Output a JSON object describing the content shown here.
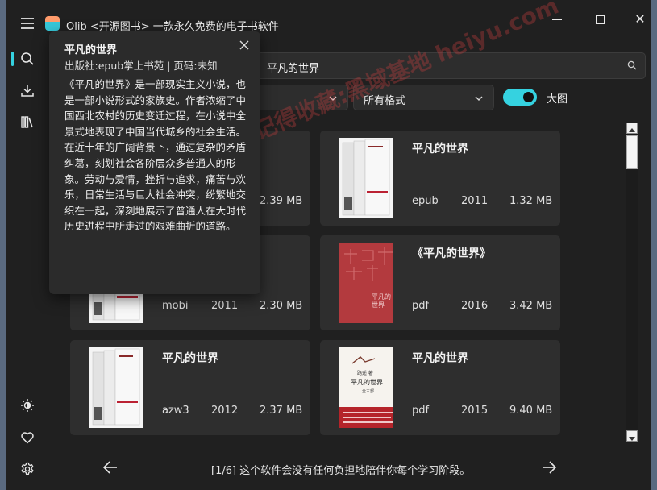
{
  "app": {
    "title": "Olib <开源图书> 一款永久免费的电子书软件"
  },
  "search": {
    "query": "平凡的世界"
  },
  "filters": {
    "sort_value": "",
    "format_value": "所有格式",
    "large_view_label": "大图",
    "large_view_on": true
  },
  "popup": {
    "title": "平凡的世界",
    "meta": "出版社:epub掌上书苑 | 页码:未知",
    "description": "《平凡的世界》是一部现实主义小说，也是一部小说形式的家族史。作者浓缩了中国西北农村的历史变迁过程，在小说中全景式地表现了中国当代城乡的社会生活。在近十年的广阔背景下，通过复杂的矛盾纠葛，刻划社会各阶层众多普通人的形象。劳动与爱情，挫折与追求，痛苦与欢乐，日常生活与巨大社会冲突，纷繁地交织在一起，深刻地展示了普通人在大时代历史进程中所走过的艰难曲折的道路。"
  },
  "results": [
    {
      "title": "",
      "format": "",
      "year": "",
      "size": "2.39 MB",
      "cover": "hidden"
    },
    {
      "title": "平凡的世界",
      "format": "epub",
      "year": "2011",
      "size": "1.32 MB",
      "cover": "white"
    },
    {
      "title": "",
      "format": "mobi",
      "year": "2011",
      "size": "2.30 MB",
      "cover": "white"
    },
    {
      "title": "《平凡的世界》",
      "format": "pdf",
      "year": "2016",
      "size": "3.42 MB",
      "cover": "red"
    },
    {
      "title": "平凡的世界",
      "format": "azw3",
      "year": "2012",
      "size": "2.37 MB",
      "cover": "white"
    },
    {
      "title": "平凡的世界",
      "format": "pdf",
      "year": "2015",
      "size": "9.40 MB",
      "cover": "white-title"
    }
  ],
  "pager": {
    "text": "[1/6] 这个软件会没有任何负担地陪伴你每个学习阶段。"
  },
  "watermark": {
    "text": "记得收藏:黑域基地 heiyu.com"
  },
  "colors": {
    "accent": "#35d2e0",
    "background": "#202020",
    "card": "#2e2e2e"
  },
  "icons": {
    "menu": "hamburger-icon",
    "search": "search-icon",
    "download": "download-icon",
    "library": "library-icon",
    "theme": "sun-icon",
    "favorite": "heart-icon",
    "settings": "gear-icon"
  }
}
